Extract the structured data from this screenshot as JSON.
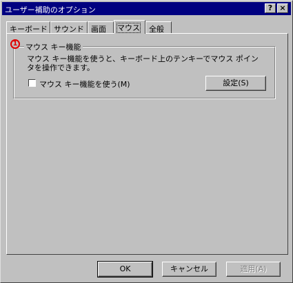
{
  "window": {
    "title": "ユーザー補助のオプション",
    "help_button": "?",
    "close_button": "×"
  },
  "tabs": [
    {
      "label": "キーボード",
      "active": false
    },
    {
      "label": "サウンド",
      "active": false
    },
    {
      "label": "画面",
      "active": false
    },
    {
      "label": "マウス",
      "active": true
    },
    {
      "label": "全般",
      "active": false
    }
  ],
  "annotation": {
    "marker": "1",
    "color": "#e00000"
  },
  "mousekeys": {
    "group_title": "マウス キー機能",
    "description": "マウス キー機能を使うと、キーボード上のテンキーでマウス ポインタを操作できます。",
    "checkbox_label": "マウス キー機能を使う(M)",
    "checked": false,
    "settings_button": "設定(S)"
  },
  "footer": {
    "ok": "OK",
    "cancel": "キャンセル",
    "apply": "適用(A)"
  },
  "colors": {
    "titlebar": "#000080",
    "face": "#c0c0c0"
  }
}
